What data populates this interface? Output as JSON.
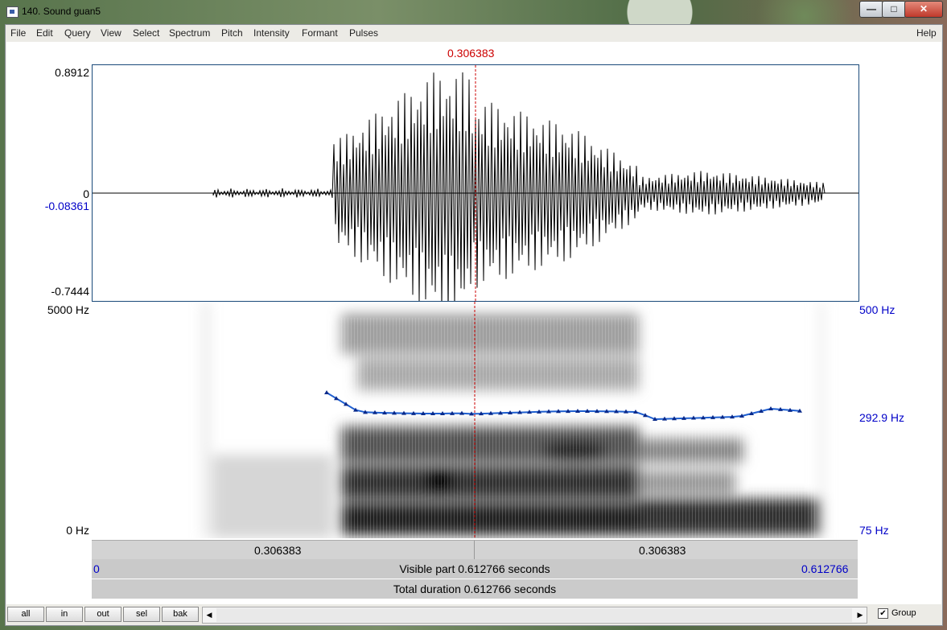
{
  "window": {
    "title": "140. Sound guan5",
    "min_glyph": "—",
    "max_glyph": "□",
    "close_glyph": "✕"
  },
  "menu": {
    "items": [
      "File",
      "Edit",
      "Query",
      "View",
      "Select",
      "Spectrum",
      "Pitch",
      "Intensity",
      "Formant",
      "Pulses"
    ],
    "help": "Help"
  },
  "cursor": {
    "time_label": "0.306383",
    "color": "#cc0000"
  },
  "waveform": {
    "y_max": "0.8912",
    "y_zero": "0",
    "y_cursor": "-0.08361",
    "y_min": "-0.7444"
  },
  "spectrogram": {
    "f_max": "5000 Hz",
    "f_min": "0 Hz",
    "pitch_top": "500 Hz",
    "pitch_mid": "292.9 Hz",
    "pitch_bottom": "75 Hz",
    "pitch_color": "#1f5fd0"
  },
  "time_bars": {
    "left_duration": "0.306383",
    "right_duration": "0.306383",
    "visible_start": "0",
    "visible_label": "Visible part 0.612766 seconds",
    "visible_end": "0.612766",
    "total_label": "Total duration 0.612766 seconds"
  },
  "toolbar": {
    "buttons": [
      "all",
      "in",
      "out",
      "sel",
      "bak"
    ],
    "scroll_left": "◀",
    "scroll_right": "▶",
    "group_checked": "✔",
    "group_label": "Group"
  }
}
